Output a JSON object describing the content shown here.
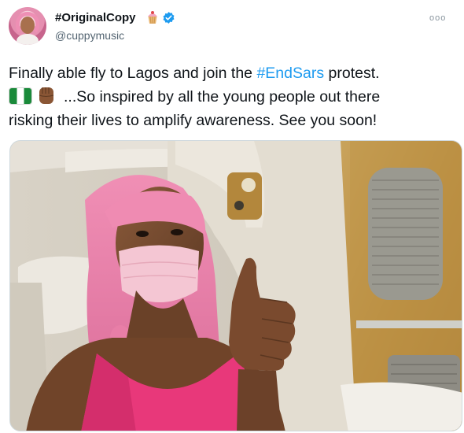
{
  "author": {
    "display_name": "#OriginalCopy",
    "handle": "@cuppymusic",
    "badge_icons": [
      "cupcake-icon",
      "verified-icon"
    ]
  },
  "more_label": "ooo",
  "tweet": {
    "line1_before": "Finally able fly to Lagos and join the ",
    "hashtag": "#EndSars",
    "line1_after": " protest.",
    "emojis": [
      "nigeria-flag-icon",
      "raised-fist-icon"
    ],
    "line2": "...So inspired by all the young people out there",
    "line3": "risking their lives to amplify awareness. See you soon!"
  },
  "media": {
    "description_icon": "photo"
  },
  "colors": {
    "link": "#1d9bf0",
    "verified": "#1d9bf0",
    "text": "#0f1419",
    "secondary": "#536471"
  }
}
